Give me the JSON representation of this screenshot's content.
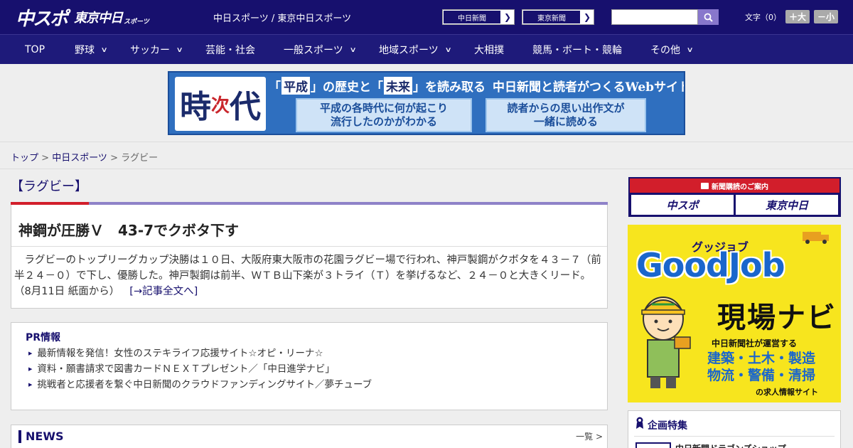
{
  "header": {
    "logo_main": "中スポ",
    "logo_sub": "東京中日",
    "logo_sub_small": "スポーツ",
    "site_name": "中日スポーツ / 東京中日スポーツ",
    "paper_links": [
      "中日新聞",
      "東京新聞"
    ],
    "search_placeholder": "",
    "font_size_label": "文字（0）",
    "font_larger": "＋大",
    "font_smaller": "－小"
  },
  "nav": {
    "items": [
      {
        "label": "TOP",
        "has_menu": false
      },
      {
        "label": "野球",
        "has_menu": true
      },
      {
        "label": "サッカー",
        "has_menu": true
      },
      {
        "label": "芸能・社会",
        "has_menu": false
      },
      {
        "label": "一般スポーツ",
        "has_menu": true
      },
      {
        "label": "地域スポーツ",
        "has_menu": true
      },
      {
        "label": "大相撲",
        "has_menu": false
      },
      {
        "label": "競馬・ボート・競輪",
        "has_menu": false
      },
      {
        "label": "その他",
        "has_menu": true
      }
    ]
  },
  "banner": {
    "logo_a": "時",
    "logo_b": "次",
    "logo_c": "代",
    "headline_prefix": "「",
    "headline_mark1": "平成",
    "headline_mid1": "」の歴史と「",
    "headline_mark2": "未来",
    "headline_mid2": "」を読み取る",
    "headline_suffix": "中日新聞と読者がつくるWebサイト",
    "box1_line1": "平成の各時代に何が起こり",
    "box1_line2": "流行したのかがわかる",
    "box2_line1": "読者からの思い出作文が",
    "box2_line2": "一緒に読める"
  },
  "breadcrumb": {
    "home": "トップ",
    "section": "中日スポーツ",
    "current": "ラグビー",
    "sep": " > "
  },
  "category_title": "【ラグビー】",
  "article": {
    "title": "神鋼が圧勝Ｖ　43-7でクボタ下す",
    "body": "　ラグビーのトップリーグカップ決勝は１０日、大阪府東大阪市の花園ラグビー場で行われ、神戸製鋼がクボタを４３－７（前半２４－０）で下し、優勝した。神戸製鋼は前半、ＷＴＢ山下楽が３トライ（Ｔ）を挙げるなど、２４－０と大きくリード。（8月11日 紙面から）",
    "read_more": "[→記事全文へ]"
  },
  "pr": {
    "heading": "PR情報",
    "items": [
      "最新情報を発信！女性のステキライフ応援サイト☆オピ・リーナ☆",
      "資料・願書請求で図書カードＮＥＸＴプレゼント／「中日進学ナビ」",
      "挑戦者と応援者を繋ぐ中日新聞のクラウドファンディングサイト／夢チューブ"
    ]
  },
  "news": {
    "heading": "NEWS",
    "more": "一覧 >"
  },
  "sidebar": {
    "subscribe_head": "新聞購読のご案内",
    "subscribe_btn1": "中スポ",
    "subscribe_btn2": "東京中日",
    "goodjob_top": "グッジョブ",
    "goodjob_title": "GoodJob",
    "goodjob_navi": "現場ナビ",
    "goodjob_text1": "中日新聞社が運営する",
    "goodjob_text2a": "建築・土木・製造",
    "goodjob_text2b": "物流・警備・清掃",
    "goodjob_text3": "の求人情報サイト",
    "feature_heading": "企画特集",
    "feature_item": "中日新聞ドラゴンズショップ"
  },
  "colors": {
    "header_bg": "#17106e",
    "nav_bg": "#1e1a7a",
    "accent_red": "#d21e2b",
    "accent_purple": "#8e82c8",
    "goodjob_yellow": "#f7e51e"
  }
}
